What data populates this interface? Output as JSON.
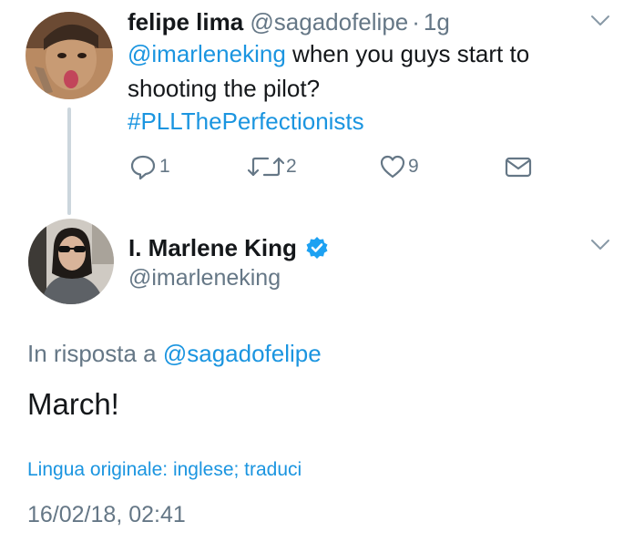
{
  "tweet": {
    "author_name": "felipe lima",
    "author_handle": "@sagadofelipe",
    "separator": "·",
    "time": "1g",
    "mention": "@imarleneking",
    "text_line1_rest": " when you guys start to",
    "text_line2": "shooting the pilot?",
    "hashtag": "#PLLThePerfectionists",
    "replies": "1",
    "retweets": "2",
    "likes": "9",
    "icons": [
      "reply-icon",
      "retweet-icon",
      "like-icon",
      "dm-icon",
      "chevron-down-icon"
    ]
  },
  "reply": {
    "author_name": "I. Marlene King",
    "author_handle": "@imarleneking",
    "verified": true,
    "reply_prefix": "In risposta a ",
    "reply_to": "@sagadofelipe",
    "text": "March!",
    "translate_label": "Lingua originale: inglese; traduci",
    "timestamp": "16/02/18, 02:41"
  },
  "colors": {
    "link": "#1b95e0",
    "muted": "#657786",
    "text": "#14171a",
    "thread_line": "#ccd6dd"
  }
}
